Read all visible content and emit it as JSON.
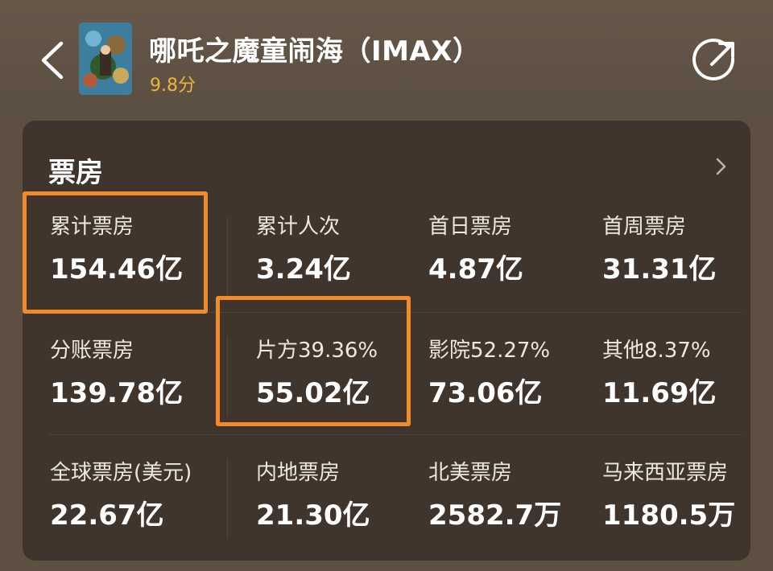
{
  "header": {
    "title": "哪吒之魔童闹海（IMAX）",
    "rating": "9.8分"
  },
  "card": {
    "title": "票房",
    "rows": [
      [
        {
          "label": "累计票房",
          "value": "154.46亿"
        },
        {
          "label": "累计人次",
          "value": "3.24亿"
        },
        {
          "label": "首日票房",
          "value": "4.87亿"
        },
        {
          "label": "首周票房",
          "value": "31.31亿"
        }
      ],
      [
        {
          "label": "分账票房",
          "value": "139.78亿"
        },
        {
          "label": "片方39.36%",
          "value": "55.02亿"
        },
        {
          "label": "影院52.27%",
          "value": "73.06亿"
        },
        {
          "label": "其他8.37%",
          "value": "11.69亿"
        }
      ],
      [
        {
          "label": "全球票房(美元)",
          "value": "22.67亿"
        },
        {
          "label": "内地票房",
          "value": "21.30亿"
        },
        {
          "label": "北美票房",
          "value": "2582.7万"
        },
        {
          "label": "马来西亚票房",
          "value": "1180.5万"
        }
      ]
    ]
  },
  "colors": {
    "background": "#5d5043",
    "card": "#3f352c",
    "rating": "#f0b43a",
    "highlight": "#f08a2a"
  },
  "icons": {
    "back": "chevron-left-icon",
    "share": "share-icon",
    "more": "chevron-right-icon"
  }
}
